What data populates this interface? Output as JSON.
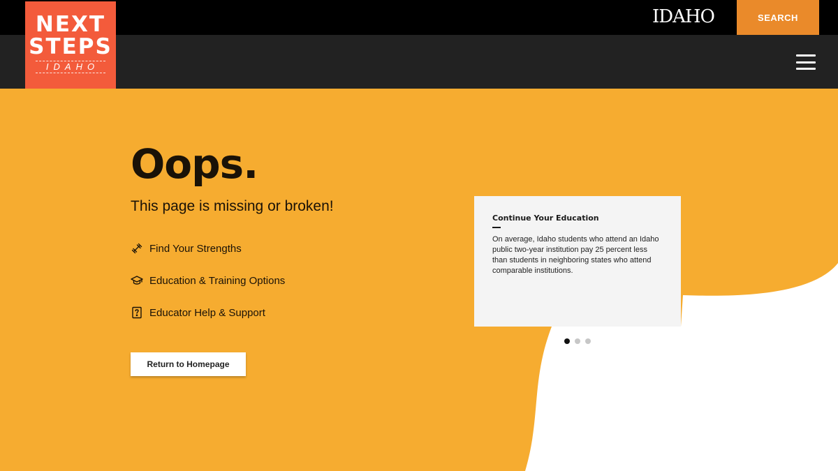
{
  "header": {
    "logo_line1": "NEXT",
    "logo_line2": "STEPS",
    "logo_line3": "IDAHO",
    "state_logo": "IDAHO",
    "search_label": "SEARCH"
  },
  "main": {
    "headline": "Oops.",
    "subhead": "This page is missing or broken!",
    "links": [
      {
        "label": "Find Your Strengths",
        "icon": "dumbbell-icon"
      },
      {
        "label": "Education & Training Options",
        "icon": "graduation-cap-icon"
      },
      {
        "label": "Educator Help & Support",
        "icon": "question-icon"
      }
    ],
    "home_button": "Return to Homepage"
  },
  "card": {
    "title": "Continue Your Education",
    "body": "On average, Idaho students who attend an Idaho public two-year institution pay 25 percent less than students in neighboring states who attend comparable institutions."
  },
  "carousel": {
    "slide_count": 3,
    "active_index": 0
  },
  "colors": {
    "background": "#f6ac30",
    "logo": "#f35b3b",
    "search": "#ea8a2a",
    "topbar": "#000000",
    "navbar": "#222222"
  }
}
